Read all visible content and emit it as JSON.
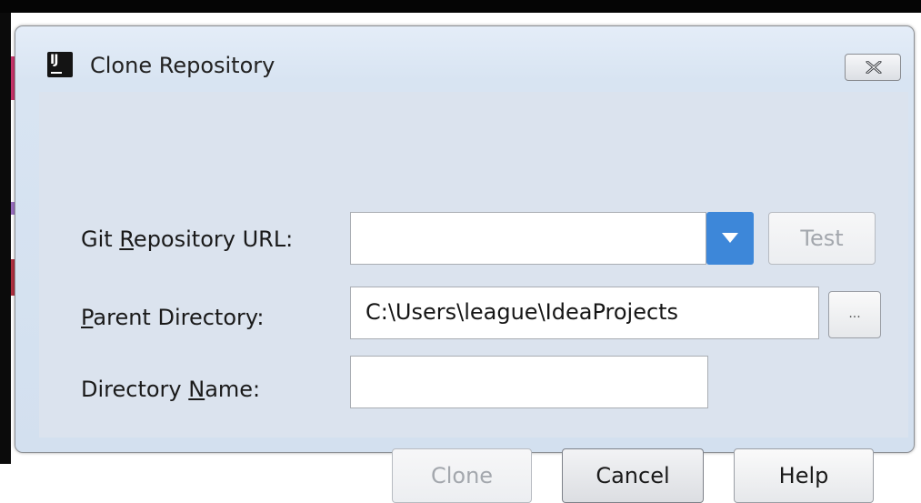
{
  "window": {
    "title": "Clone Repository",
    "app_icon_text": "IJ"
  },
  "form": {
    "git_url": {
      "label_prefix": "Git ",
      "label_mnemonic": "R",
      "label_suffix": "epository URL:",
      "value": ""
    },
    "parent_directory": {
      "label_prefix": "",
      "label_mnemonic": "P",
      "label_suffix": "arent Directory:",
      "value": "C:\\Users\\league\\IdeaProjects"
    },
    "directory_name": {
      "label_prefix": "Directory ",
      "label_mnemonic": "N",
      "label_suffix": "ame:",
      "value": ""
    }
  },
  "buttons": {
    "test": "Test",
    "browse": "...",
    "clone": "Clone",
    "cancel": "Cancel",
    "help": "Help"
  },
  "icons": {
    "app": "intellij-idea-icon",
    "close": "close-x-icon",
    "dropdown": "triangle-down-icon"
  },
  "colors": {
    "dropdown_accent": "#3d87d9",
    "dialog_background": "#dbe3ee"
  }
}
